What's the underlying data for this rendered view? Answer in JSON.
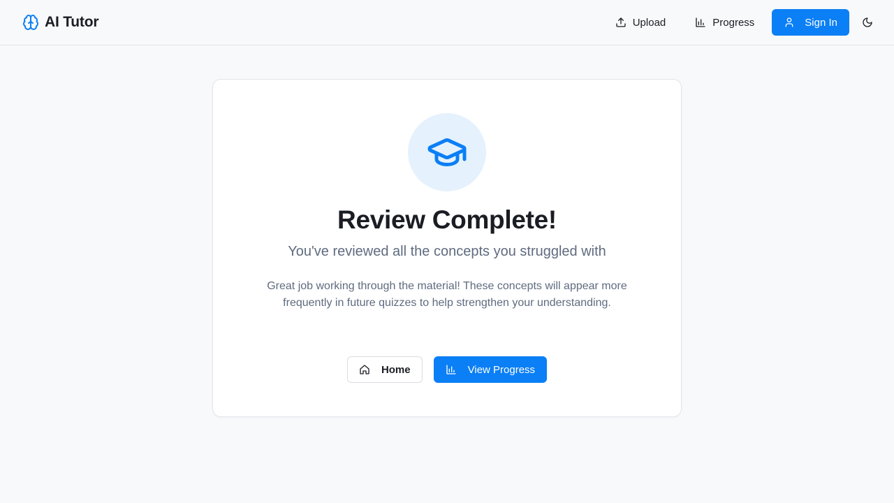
{
  "app": {
    "name": "AI Tutor",
    "logo_icon": "brain-icon"
  },
  "nav": {
    "upload_label": "Upload",
    "upload_icon": "upload-icon",
    "progress_label": "Progress",
    "progress_icon": "bar-chart-icon",
    "signin_label": "Sign In",
    "signin_icon": "user-icon",
    "theme_icon": "moon-icon"
  },
  "review": {
    "icon": "graduation-cap-icon",
    "title": "Review Complete!",
    "subtitle": "You've reviewed all the concepts you struggled with",
    "message": "Great job working through the material! These concepts will appear more frequently in future quizzes to help strengthen your understanding.",
    "home_label": "Home",
    "home_icon": "home-icon",
    "view_progress_label": "View Progress",
    "view_progress_icon": "bar-chart-icon"
  },
  "colors": {
    "accent": "#0b7ff5",
    "accent_soft": "#e5f1fd",
    "text": "#1a1d23",
    "muted": "#5f6b7f",
    "background": "#f8f9fb"
  }
}
